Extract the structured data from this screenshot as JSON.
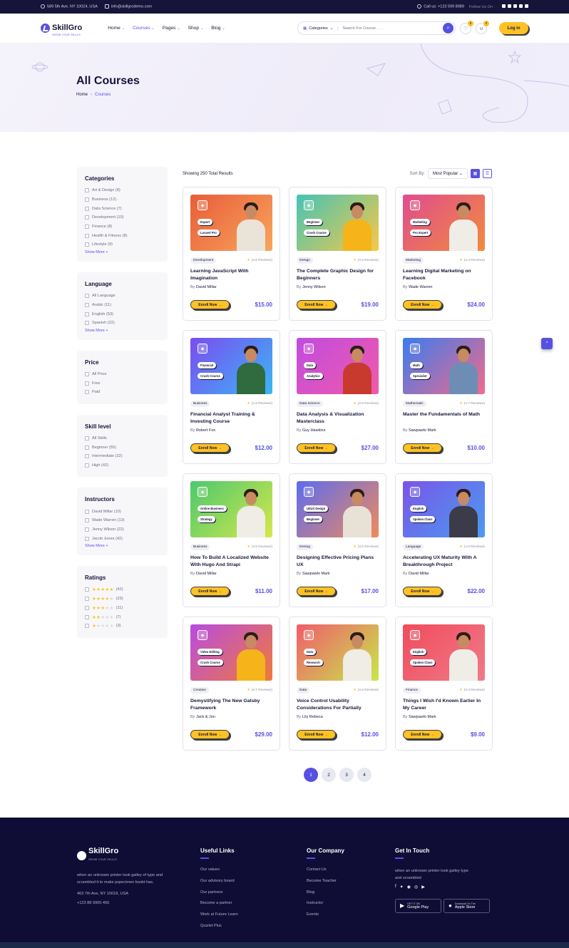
{
  "topbar": {
    "address": "589 5th Ave, NY 10024, USA",
    "email": "info@skillgrodemo.com",
    "call_label": "Call us:",
    "phone": "+123 599 8989",
    "follow": "Follow Us On :"
  },
  "header": {
    "logo": "SkillGro",
    "logo_tagline": "GROW YOUR SKILLS",
    "nav": [
      "Home",
      "Courses",
      "Pages",
      "Shop",
      "Blog"
    ],
    "search_category": "Categories",
    "search_placeholder": "Search For Course . . .",
    "wishlist_count": "0",
    "cart_count": "0",
    "login": "Log in"
  },
  "hero": {
    "title": "All Courses",
    "breadcrumb_home": "Home",
    "breadcrumb_current": "Courses"
  },
  "filters": {
    "categories": {
      "title": "Categories",
      "items": [
        "Art & Design (8)",
        "Business (12)",
        "Data Science (7)",
        "Development (10)",
        "Finance (8)",
        "Health & Fitness (8)",
        "Lifestyle (9)"
      ],
      "more": "Show More +"
    },
    "language": {
      "title": "Language",
      "items": [
        "All Language",
        "Arabic (11)",
        "English (53)",
        "Spanish (22)"
      ],
      "more": "Show More +"
    },
    "price": {
      "title": "Price",
      "items": [
        "All Price",
        "Free",
        "Paid"
      ]
    },
    "skill": {
      "title": "Skill level",
      "items": [
        "All Skills",
        "Beginner (55)",
        "Intermediate (22)",
        "High (42)"
      ]
    },
    "instructors": {
      "title": "Instructors",
      "items": [
        "David Millar (10)",
        "Wade Warren (13)",
        "Jenny Wilson (22)",
        "Jacob Jones (42)"
      ],
      "more": "Show More +"
    },
    "ratings": {
      "title": "Ratings",
      "items": [
        {
          "stars": 5,
          "count": "(42)"
        },
        {
          "stars": 4,
          "count": "(23)"
        },
        {
          "stars": 3,
          "count": "(11)"
        },
        {
          "stars": 2,
          "count": "(7)"
        },
        {
          "stars": 1,
          "count": "(3)"
        }
      ]
    }
  },
  "results": {
    "showing": "Showing 250 Total Results",
    "sort_label": "Sort By:",
    "sort_value": "Most Popular"
  },
  "courses": [
    {
      "tag": "Development",
      "reviews": "(4.8 Reviews)",
      "title": "Learning JavaScript With Imagination",
      "by": "By",
      "author": "David Millar",
      "enroll": "Enroll Now →",
      "price": "$15.00",
      "pill1": "Expert",
      "pill2": "Laravel Pro",
      "bg": "#e85d3a",
      "bg2": "#f8a55c",
      "shirt": "#e9e3d8"
    },
    {
      "tag": "Design",
      "reviews": "(4.5 Reviews)",
      "title": "The Complete Graphic Design for Beginners",
      "by": "By",
      "author": "Jenny Wilson",
      "enroll": "Enroll Now →",
      "price": "$19.00",
      "pill1": "Beginner",
      "pill2": "Crush Course",
      "bg": "#45c4b5",
      "bg2": "#f7c847",
      "shirt": "#f4b41a"
    },
    {
      "tag": "Marketing",
      "reviews": "(4.3 Reviews)",
      "title": "Learning Digital Marketing on Facebook",
      "by": "By",
      "author": "Wade Warren",
      "enroll": "Enroll Now →",
      "price": "$24.00",
      "pill1": "Marketing",
      "pill2": "Pro Expert",
      "bg": "#e04c8f",
      "bg2": "#f28b3d",
      "shirt": "#f0ece6"
    },
    {
      "tag": "Business",
      "reviews": "(4.8 Reviews)",
      "title": "Financial Analyst Training & Investing Course",
      "by": "By",
      "author": "Robert Fox",
      "enroll": "Enroll Now →",
      "price": "$12.00",
      "pill1": "Financial",
      "pill2": "Crush Course",
      "bg": "#7b4cf0",
      "bg2": "#3bb6f5",
      "shirt": "#2f6b3e"
    },
    {
      "tag": "Data Science",
      "reviews": "(4.5 Reviews)",
      "title": "Data Analysis & Visualization Masterclass",
      "by": "By",
      "author": "Guy Hawkins",
      "enroll": "Enroll Now →",
      "price": "$27.00",
      "pill1": "Data",
      "pill2": "Analytics",
      "bg": "#c04ce0",
      "bg2": "#f15aa8",
      "shirt": "#c73a2d"
    },
    {
      "tag": "Mathematic",
      "reviews": "(4.7 Reviews)",
      "title": "Master the Fundamentals of Math",
      "by": "By",
      "author": "Sawpawlo Mark",
      "enroll": "Enroll Now →",
      "price": "$10.00",
      "pill1": "Math",
      "pill2": "Specialist",
      "bg": "#3a7cf0",
      "bg2": "#f16b8a",
      "shirt": "#6e8db6"
    },
    {
      "tag": "Business",
      "reviews": "(4.8 Reviews)",
      "title": "How To Build A Localized Website With Hugo And Strapi",
      "by": "By",
      "author": "David Millar",
      "enroll": "Enroll Now →",
      "price": "$11.00",
      "pill1": "Online Business",
      "pill2": "Strategy",
      "bg": "#4cc86e",
      "bg2": "#d6e84a",
      "shirt": "#f0ece6"
    },
    {
      "tag": "Desing",
      "reviews": "(4.5 Reviews)",
      "title": "Designing Effective Pricing Plans UX",
      "by": "By",
      "author": "Sawpawlo Mark",
      "enroll": "Enroll Now →",
      "price": "$17.00",
      "pill1": "UI/UX Design",
      "pill2": "Beginner",
      "bg": "#5c6cf0",
      "bg2": "#f08a5c",
      "shirt": "#e8e1d6"
    },
    {
      "tag": "Language",
      "reviews": "(4.6 Reviews)",
      "title": "Accelerating UX Maturity With A Breakthrough Project",
      "by": "By",
      "author": "David Millar",
      "enroll": "Enroll Now →",
      "price": "$22.00",
      "pill1": "English",
      "pill2": "Spoken Class",
      "bg": "#7a55e8",
      "bg2": "#4a9cf0",
      "shirt": "#3b3b4a"
    },
    {
      "tag": "Creative",
      "reviews": "(4.7 Reviews)",
      "title": "Demystifying The New Gatsby Framework",
      "by": "By",
      "author": "Jack & Jon",
      "enroll": "Enroll Now →",
      "price": "$29.00",
      "pill1": "Video Editing",
      "pill2": "Crush Course",
      "bg": "#b84ce0",
      "bg2": "#f07a3a",
      "shirt": "#f4b41a"
    },
    {
      "tag": "Data",
      "reviews": "(4.8 Reviews)",
      "title": "Voice Control Usability Considerations For Partially",
      "by": "By",
      "author": "Lily Rebeca",
      "enroll": "Enroll Now →",
      "price": "$12.00",
      "pill1": "Data",
      "pill2": "Research",
      "bg": "#f05c6c",
      "bg2": "#c8e84a",
      "shirt": "#f0ece6"
    },
    {
      "tag": "Finance",
      "reviews": "(4.3 Reviews)",
      "title": "Things I Wish I'd Known Earlier In My Career",
      "by": "By",
      "author": "Sawpawlo Mark",
      "enroll": "Enroll Now →",
      "price": "$9.00",
      "pill1": "English",
      "pill2": "Spoken Class",
      "bg": "#f04c5c",
      "bg2": "#f07a8a",
      "shirt": "#f0ece6"
    }
  ],
  "pagination": [
    "1",
    "2",
    "3",
    "4"
  ],
  "footer": {
    "logo": "SkillGro",
    "logo_tagline": "GROW YOUR SKILLS",
    "about": "when an unknown printer took galley of type and scrambled it to make pspecimen bookt has.",
    "address": "463 7th Ave, NY 10018, USA",
    "phone": "+123 88 9900 456",
    "useful_title": "Useful Links",
    "useful": [
      "Our values",
      "Our advisory board",
      "Our partners",
      "Become a partner",
      "Work at Future Learn",
      "Quizlet Plus"
    ],
    "company_title": "Our Company",
    "company": [
      "Contact Us",
      "Become Teacher",
      "Blog",
      "Instructor",
      "Events"
    ],
    "touch_title": "Get In Touch",
    "touch_text": "when an unknown printer took galley type and scrambled",
    "google_small": "GET IT ON",
    "google": "Google Play",
    "apple_small": "Download On The",
    "apple": "Apple Store"
  },
  "colors": {
    "primary": "#5751e1",
    "accent": "#ffc224",
    "dark": "#161439",
    "footer": "#0f0d35"
  }
}
